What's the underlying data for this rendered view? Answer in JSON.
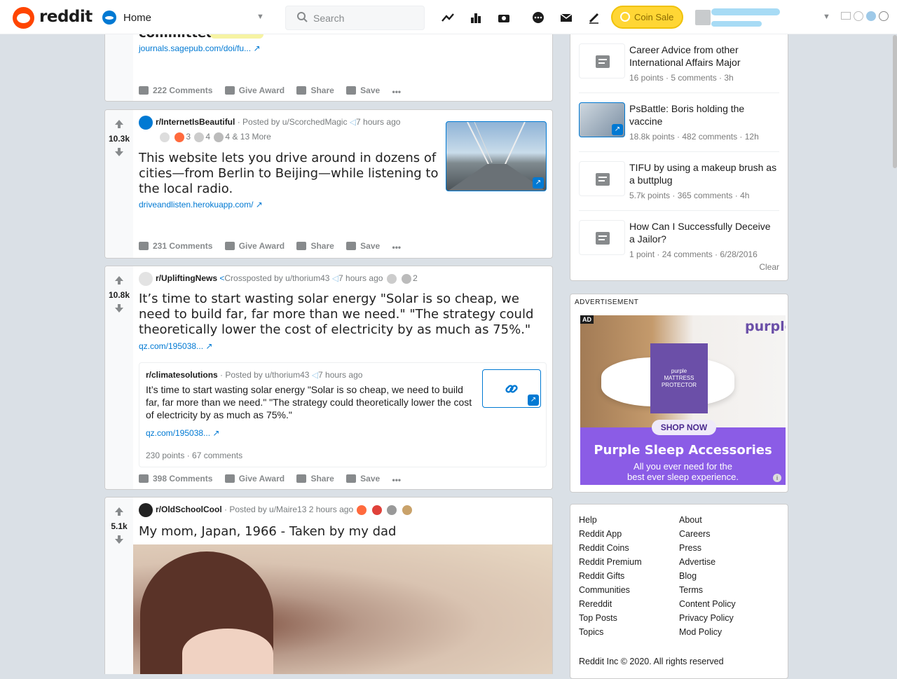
{
  "header": {
    "logo_text": "reddit",
    "feed_label": "Home",
    "search_placeholder": "Search",
    "coin_sale_label": "Coin Sale",
    "icons": [
      "trending-icon",
      "stats-icon",
      "rpan-icon",
      "chat-icon",
      "mail-icon",
      "create-post-icon"
    ]
  },
  "posts": [
    {
      "title_fragment": "committed.",
      "link": "journals.sagepub.com/doi/fu...",
      "actions": {
        "comments": "222 Comments",
        "award": "Give Award",
        "share": "Share",
        "save": "Save",
        "more": "•••"
      }
    },
    {
      "score": "10.3k",
      "subreddit": "r/InternetIsBeautiful",
      "posted_by": "· Posted by u/ScorchedMagic",
      "time": "7 hours ago",
      "awards": {
        "a": "3",
        "b": "4",
        "c": "4",
        "more": "& 13 More"
      },
      "title": "This website lets you drive around in dozens of cities—from Berlin to Beijing—while listening to the local radio.",
      "link": "driveandlisten.herokuapp.com/",
      "actions": {
        "comments": "231 Comments",
        "award": "Give Award",
        "share": "Share",
        "save": "Save",
        "more": "•••"
      }
    },
    {
      "score": "10.8k",
      "subreddit": "r/UpliftingNews",
      "posted_by": "Crossposted by u/thorium43",
      "time": "7 hours ago",
      "awards": {
        "a": "2"
      },
      "title": "It’s time to start wasting solar energy \"Solar is so cheap, we need to build far, far more than we need.\" \"The strategy could theoretically lower the cost of electricity by as much as 75%.\"",
      "link": "qz.com/195038...",
      "crosspost": {
        "subreddit": "r/climatesolutions",
        "posted_by": "· Posted by u/thorium43",
        "time": "7 hours ago",
        "title": "It’s time to start wasting solar energy \"Solar is so cheap, we need to build far, far more than we need.\" \"The strategy could theoretically lower the cost of electricity by as much as 75%.\"",
        "link": "qz.com/195038...",
        "stats": "230 points · 67 comments"
      },
      "actions": {
        "comments": "398 Comments",
        "award": "Give Award",
        "share": "Share",
        "save": "Save",
        "more": "•••"
      }
    },
    {
      "score": "5.1k",
      "subreddit": "r/OldSchoolCool",
      "posted_by": "· Posted by u/Maire13 2 hours ago",
      "title": "My mom, Japan, 1966 - Taken by my dad"
    }
  ],
  "recent_posts": {
    "items": [
      {
        "title": "Career Advice from other International Affairs Major",
        "meta": "16 points · 5 comments · 3h"
      },
      {
        "title": "PsBattle: Boris holding the vaccine",
        "meta": "18.8k points · 482 comments · 12h"
      },
      {
        "title": "TIFU by using a makeup brush as a buttplug",
        "meta": "5.7k points · 365 comments · 4h"
      },
      {
        "title": "How Can I Successfully Deceive a Jailor?",
        "meta": "1 point · 24 comments · 6/28/2016"
      }
    ],
    "clear_label": "Clear"
  },
  "ad": {
    "label": "ADVERTISEMENT",
    "badge": "AD",
    "brand": "purple",
    "product_lines": [
      "purple",
      "MATTRESS",
      "PROTECTOR"
    ],
    "cta": "SHOP NOW",
    "headline": "Purple Sleep Accessories",
    "tagline_1": "All you ever need for the",
    "tagline_2": "best ever sleep experience."
  },
  "footer": {
    "left": [
      "Help",
      "Reddit App",
      "Reddit Coins",
      "Reddit Premium",
      "Reddit Gifts",
      "Communities",
      "Rereddit",
      "Top Posts",
      "Topics"
    ],
    "right": [
      "About",
      "Careers",
      "Press",
      "Advertise",
      "Blog",
      "Terms",
      "Content Policy",
      "Privacy Policy",
      "Mod Policy"
    ],
    "copyright": "Reddit Inc © 2020. All rights reserved"
  },
  "colors": {
    "brand": "#ff4500",
    "link": "#0079d3",
    "coin": "#ffd635",
    "ad_purple": "#8b5ce6"
  }
}
